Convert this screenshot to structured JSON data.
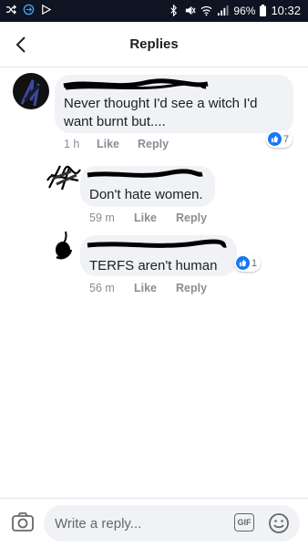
{
  "statusbar": {
    "battery": "96%",
    "time": "10:32",
    "icons": [
      "shuffle-icon",
      "vpn-icon",
      "play-icon",
      "bluetooth-icon",
      "mute-icon",
      "wifi-icon",
      "signal-icon",
      "battery-icon"
    ]
  },
  "header": {
    "title": "Replies",
    "back_icon": "back-arrow-icon"
  },
  "comments": [
    {
      "text": "Never thought I'd see a witch I'd want burnt but....",
      "time": "1 h",
      "like_label": "Like",
      "reply_label": "Reply",
      "reaction_count": "7"
    },
    {
      "text": "Don't hate women.",
      "time": "59 m",
      "like_label": "Like",
      "reply_label": "Reply"
    },
    {
      "text": "TERFS aren't human",
      "time": "56 m",
      "like_label": "Like",
      "reply_label": "Reply",
      "reaction_count": "1"
    }
  ],
  "footer": {
    "placeholder": "Write a reply...",
    "gif_label": "GIF",
    "camera_icon": "camera-icon",
    "emoji_icon": "emoji-icon"
  },
  "colors": {
    "statusbar_bg": "#0f1422",
    "bubble_bg": "#f0f2f5",
    "like_blue": "#1877f2",
    "meta_gray": "#8a8d91"
  }
}
